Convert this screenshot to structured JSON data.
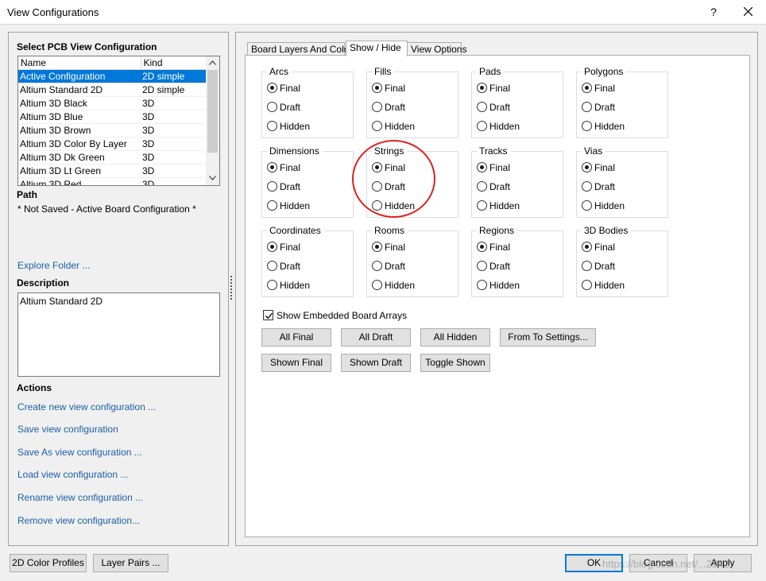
{
  "window": {
    "title": "View Configurations",
    "help_glyph": "?"
  },
  "left": {
    "select_heading": "Select PCB View Configuration",
    "columns": [
      "Name",
      "Kind"
    ],
    "rows": [
      {
        "name": "Active Configuration",
        "kind": "2D simple",
        "selected": true
      },
      {
        "name": "Altium Standard 2D",
        "kind": "2D simple"
      },
      {
        "name": "Altium 3D Black",
        "kind": "3D"
      },
      {
        "name": "Altium 3D Blue",
        "kind": "3D"
      },
      {
        "name": "Altium 3D Brown",
        "kind": "3D"
      },
      {
        "name": "Altium 3D Color By Layer",
        "kind": "3D"
      },
      {
        "name": "Altium 3D Dk Green",
        "kind": "3D"
      },
      {
        "name": "Altium 3D Lt Green",
        "kind": "3D"
      },
      {
        "name": "Altium 3D Red",
        "kind": "3D"
      }
    ],
    "path_heading": "Path",
    "path_value": "* Not Saved - Active Board Configuration *",
    "explore_link": "Explore Folder ...",
    "description_heading": "Description",
    "description_value": "Altium Standard 2D",
    "actions_heading": "Actions",
    "actions": [
      "Create new view configuration ...",
      "Save view configuration",
      "Save As view configuration ...",
      "Load view configuration ...",
      "Rename view configuration ...",
      "Remove view configuration..."
    ]
  },
  "tabs": [
    "Board Layers And Colors",
    "Show / Hide",
    "View Options"
  ],
  "active_tab": 1,
  "option_labels": [
    "Final",
    "Draft",
    "Hidden"
  ],
  "groups": [
    {
      "title": "Arcs",
      "selected": 0
    },
    {
      "title": "Fills",
      "selected": 0
    },
    {
      "title": "Pads",
      "selected": 0
    },
    {
      "title": "Polygons",
      "selected": 0
    },
    {
      "title": "Dimensions",
      "selected": 0
    },
    {
      "title": "Strings",
      "selected": 0
    },
    {
      "title": "Tracks",
      "selected": 0
    },
    {
      "title": "Vias",
      "selected": 0
    },
    {
      "title": "Coordinates",
      "selected": 0
    },
    {
      "title": "Rooms",
      "selected": 0
    },
    {
      "title": "Regions",
      "selected": 0
    },
    {
      "title": "3D Bodies",
      "selected": 0
    }
  ],
  "show_embedded": {
    "label": "Show Embedded Board Arrays",
    "checked": true
  },
  "buttons": {
    "all_final": "All Final",
    "all_draft": "All Draft",
    "all_hidden": "All Hidden",
    "from_to": "From To Settings...",
    "shown_final": "Shown Final",
    "shown_draft": "Shown Draft",
    "toggle_shown": "Toggle Shown"
  },
  "footer": {
    "color_profiles": "2D Color Profiles",
    "layer_pairs": "Layer Pairs ...",
    "ok": "OK",
    "cancel": "Cancel",
    "apply": "Apply"
  },
  "watermark": "https://blog.csdn.net/...2242",
  "colors": {
    "accent": "#0078d7",
    "link": "#1c5fa6",
    "annotation": "#e02020"
  }
}
